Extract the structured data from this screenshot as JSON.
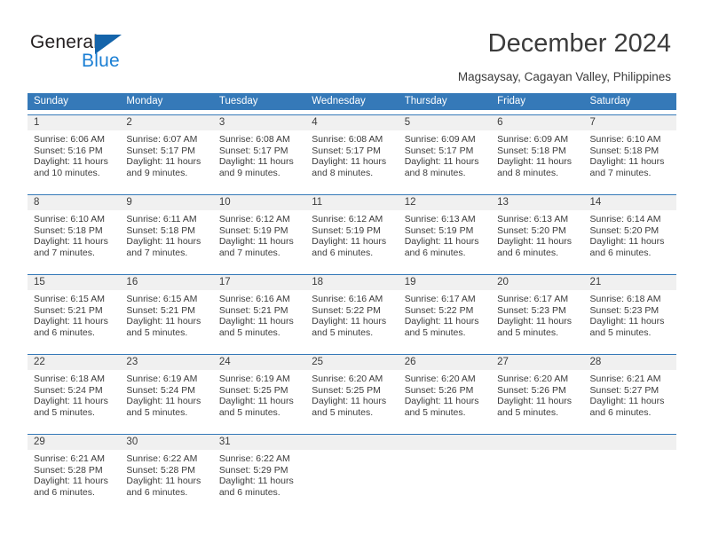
{
  "logo": {
    "word_one": "General",
    "word_two": "Blue",
    "triangle_icon": "blue-triangle-icon",
    "brand_dark": "#231f20",
    "brand_blue": "#1b7fd4"
  },
  "header": {
    "title": "December 2024",
    "subtitle": "Magsaysay, Cagayan Valley, Philippines"
  },
  "colors": {
    "header_blue": "#3579b8",
    "daynum_gray": "#f0f0f0",
    "text": "#3c3c3c"
  },
  "weekdays": [
    "Sunday",
    "Monday",
    "Tuesday",
    "Wednesday",
    "Thursday",
    "Friday",
    "Saturday"
  ],
  "weeks": [
    {
      "days": [
        {
          "day": "1",
          "sunrise": "Sunrise: 6:06 AM",
          "sunset": "Sunset: 5:16 PM",
          "daylight1": "Daylight: 11 hours",
          "daylight2": "and 10 minutes."
        },
        {
          "day": "2",
          "sunrise": "Sunrise: 6:07 AM",
          "sunset": "Sunset: 5:17 PM",
          "daylight1": "Daylight: 11 hours",
          "daylight2": "and 9 minutes."
        },
        {
          "day": "3",
          "sunrise": "Sunrise: 6:08 AM",
          "sunset": "Sunset: 5:17 PM",
          "daylight1": "Daylight: 11 hours",
          "daylight2": "and 9 minutes."
        },
        {
          "day": "4",
          "sunrise": "Sunrise: 6:08 AM",
          "sunset": "Sunset: 5:17 PM",
          "daylight1": "Daylight: 11 hours",
          "daylight2": "and 8 minutes."
        },
        {
          "day": "5",
          "sunrise": "Sunrise: 6:09 AM",
          "sunset": "Sunset: 5:17 PM",
          "daylight1": "Daylight: 11 hours",
          "daylight2": "and 8 minutes."
        },
        {
          "day": "6",
          "sunrise": "Sunrise: 6:09 AM",
          "sunset": "Sunset: 5:18 PM",
          "daylight1": "Daylight: 11 hours",
          "daylight2": "and 8 minutes."
        },
        {
          "day": "7",
          "sunrise": "Sunrise: 6:10 AM",
          "sunset": "Sunset: 5:18 PM",
          "daylight1": "Daylight: 11 hours",
          "daylight2": "and 7 minutes."
        }
      ]
    },
    {
      "days": [
        {
          "day": "8",
          "sunrise": "Sunrise: 6:10 AM",
          "sunset": "Sunset: 5:18 PM",
          "daylight1": "Daylight: 11 hours",
          "daylight2": "and 7 minutes."
        },
        {
          "day": "9",
          "sunrise": "Sunrise: 6:11 AM",
          "sunset": "Sunset: 5:18 PM",
          "daylight1": "Daylight: 11 hours",
          "daylight2": "and 7 minutes."
        },
        {
          "day": "10",
          "sunrise": "Sunrise: 6:12 AM",
          "sunset": "Sunset: 5:19 PM",
          "daylight1": "Daylight: 11 hours",
          "daylight2": "and 7 minutes."
        },
        {
          "day": "11",
          "sunrise": "Sunrise: 6:12 AM",
          "sunset": "Sunset: 5:19 PM",
          "daylight1": "Daylight: 11 hours",
          "daylight2": "and 6 minutes."
        },
        {
          "day": "12",
          "sunrise": "Sunrise: 6:13 AM",
          "sunset": "Sunset: 5:19 PM",
          "daylight1": "Daylight: 11 hours",
          "daylight2": "and 6 minutes."
        },
        {
          "day": "13",
          "sunrise": "Sunrise: 6:13 AM",
          "sunset": "Sunset: 5:20 PM",
          "daylight1": "Daylight: 11 hours",
          "daylight2": "and 6 minutes."
        },
        {
          "day": "14",
          "sunrise": "Sunrise: 6:14 AM",
          "sunset": "Sunset: 5:20 PM",
          "daylight1": "Daylight: 11 hours",
          "daylight2": "and 6 minutes."
        }
      ]
    },
    {
      "days": [
        {
          "day": "15",
          "sunrise": "Sunrise: 6:15 AM",
          "sunset": "Sunset: 5:21 PM",
          "daylight1": "Daylight: 11 hours",
          "daylight2": "and 6 minutes."
        },
        {
          "day": "16",
          "sunrise": "Sunrise: 6:15 AM",
          "sunset": "Sunset: 5:21 PM",
          "daylight1": "Daylight: 11 hours",
          "daylight2": "and 5 minutes."
        },
        {
          "day": "17",
          "sunrise": "Sunrise: 6:16 AM",
          "sunset": "Sunset: 5:21 PM",
          "daylight1": "Daylight: 11 hours",
          "daylight2": "and 5 minutes."
        },
        {
          "day": "18",
          "sunrise": "Sunrise: 6:16 AM",
          "sunset": "Sunset: 5:22 PM",
          "daylight1": "Daylight: 11 hours",
          "daylight2": "and 5 minutes."
        },
        {
          "day": "19",
          "sunrise": "Sunrise: 6:17 AM",
          "sunset": "Sunset: 5:22 PM",
          "daylight1": "Daylight: 11 hours",
          "daylight2": "and 5 minutes."
        },
        {
          "day": "20",
          "sunrise": "Sunrise: 6:17 AM",
          "sunset": "Sunset: 5:23 PM",
          "daylight1": "Daylight: 11 hours",
          "daylight2": "and 5 minutes."
        },
        {
          "day": "21",
          "sunrise": "Sunrise: 6:18 AM",
          "sunset": "Sunset: 5:23 PM",
          "daylight1": "Daylight: 11 hours",
          "daylight2": "and 5 minutes."
        }
      ]
    },
    {
      "days": [
        {
          "day": "22",
          "sunrise": "Sunrise: 6:18 AM",
          "sunset": "Sunset: 5:24 PM",
          "daylight1": "Daylight: 11 hours",
          "daylight2": "and 5 minutes."
        },
        {
          "day": "23",
          "sunrise": "Sunrise: 6:19 AM",
          "sunset": "Sunset: 5:24 PM",
          "daylight1": "Daylight: 11 hours",
          "daylight2": "and 5 minutes."
        },
        {
          "day": "24",
          "sunrise": "Sunrise: 6:19 AM",
          "sunset": "Sunset: 5:25 PM",
          "daylight1": "Daylight: 11 hours",
          "daylight2": "and 5 minutes."
        },
        {
          "day": "25",
          "sunrise": "Sunrise: 6:20 AM",
          "sunset": "Sunset: 5:25 PM",
          "daylight1": "Daylight: 11 hours",
          "daylight2": "and 5 minutes."
        },
        {
          "day": "26",
          "sunrise": "Sunrise: 6:20 AM",
          "sunset": "Sunset: 5:26 PM",
          "daylight1": "Daylight: 11 hours",
          "daylight2": "and 5 minutes."
        },
        {
          "day": "27",
          "sunrise": "Sunrise: 6:20 AM",
          "sunset": "Sunset: 5:26 PM",
          "daylight1": "Daylight: 11 hours",
          "daylight2": "and 5 minutes."
        },
        {
          "day": "28",
          "sunrise": "Sunrise: 6:21 AM",
          "sunset": "Sunset: 5:27 PM",
          "daylight1": "Daylight: 11 hours",
          "daylight2": "and 6 minutes."
        }
      ]
    },
    {
      "days": [
        {
          "day": "29",
          "sunrise": "Sunrise: 6:21 AM",
          "sunset": "Sunset: 5:28 PM",
          "daylight1": "Daylight: 11 hours",
          "daylight2": "and 6 minutes."
        },
        {
          "day": "30",
          "sunrise": "Sunrise: 6:22 AM",
          "sunset": "Sunset: 5:28 PM",
          "daylight1": "Daylight: 11 hours",
          "daylight2": "and 6 minutes."
        },
        {
          "day": "31",
          "sunrise": "Sunrise: 6:22 AM",
          "sunset": "Sunset: 5:29 PM",
          "daylight1": "Daylight: 11 hours",
          "daylight2": "and 6 minutes."
        },
        {
          "day": "",
          "sunrise": "",
          "sunset": "",
          "daylight1": "",
          "daylight2": ""
        },
        {
          "day": "",
          "sunrise": "",
          "sunset": "",
          "daylight1": "",
          "daylight2": ""
        },
        {
          "day": "",
          "sunrise": "",
          "sunset": "",
          "daylight1": "",
          "daylight2": ""
        },
        {
          "day": "",
          "sunrise": "",
          "sunset": "",
          "daylight1": "",
          "daylight2": ""
        }
      ]
    }
  ]
}
